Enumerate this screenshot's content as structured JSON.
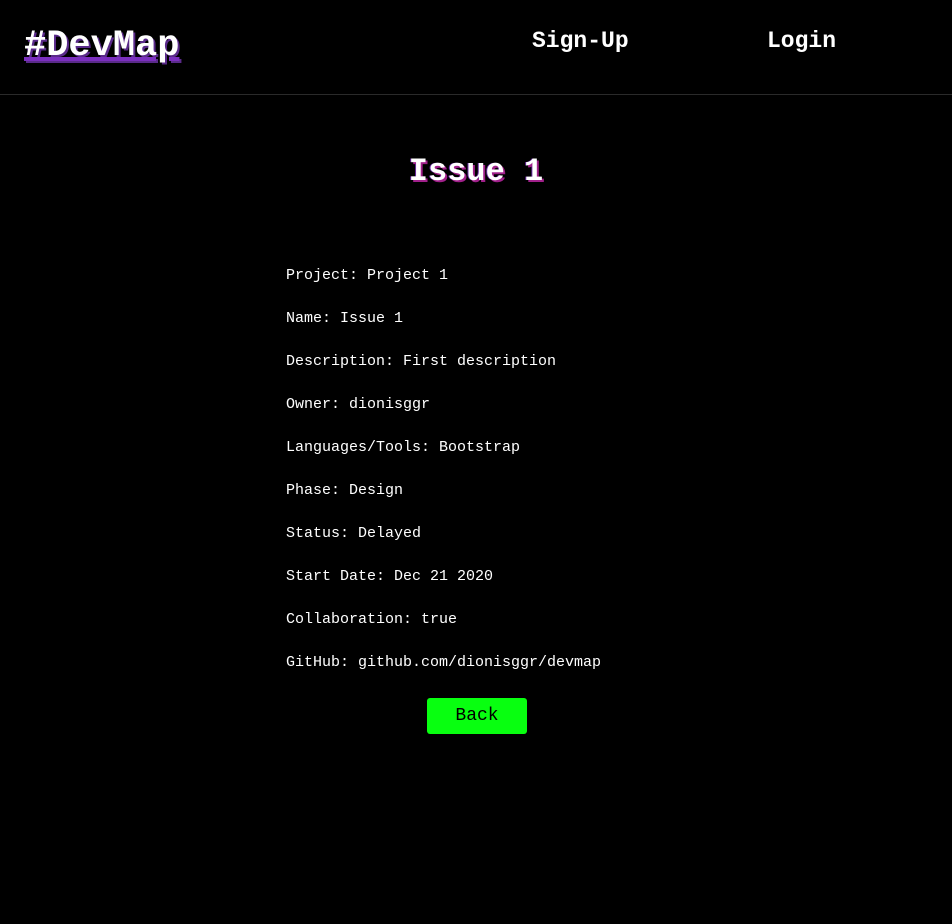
{
  "navbar": {
    "brand": "#DevMap",
    "links": [
      {
        "label": "Sign-Up"
      },
      {
        "label": "Login"
      }
    ]
  },
  "issue": {
    "title": "Issue 1",
    "details": [
      {
        "text": "Project: Project 1"
      },
      {
        "text": "Name: Issue 1"
      },
      {
        "text": "Description: First description"
      },
      {
        "text": "Owner: dionisggr"
      },
      {
        "text": "Languages/Tools: Bootstrap"
      },
      {
        "text": "Phase: Design"
      },
      {
        "text": "Status: Delayed"
      },
      {
        "text": "Start Date: Dec 21 2020"
      },
      {
        "text": "Collaboration: true"
      },
      {
        "text": "GitHub: github.com/dionisggr/devmap"
      }
    ]
  },
  "actions": {
    "back_label": "Back"
  },
  "colors": {
    "background": "#000000",
    "text": "#ffffff",
    "brand_accent": "#7b2fbe",
    "button": "#08ff10"
  }
}
